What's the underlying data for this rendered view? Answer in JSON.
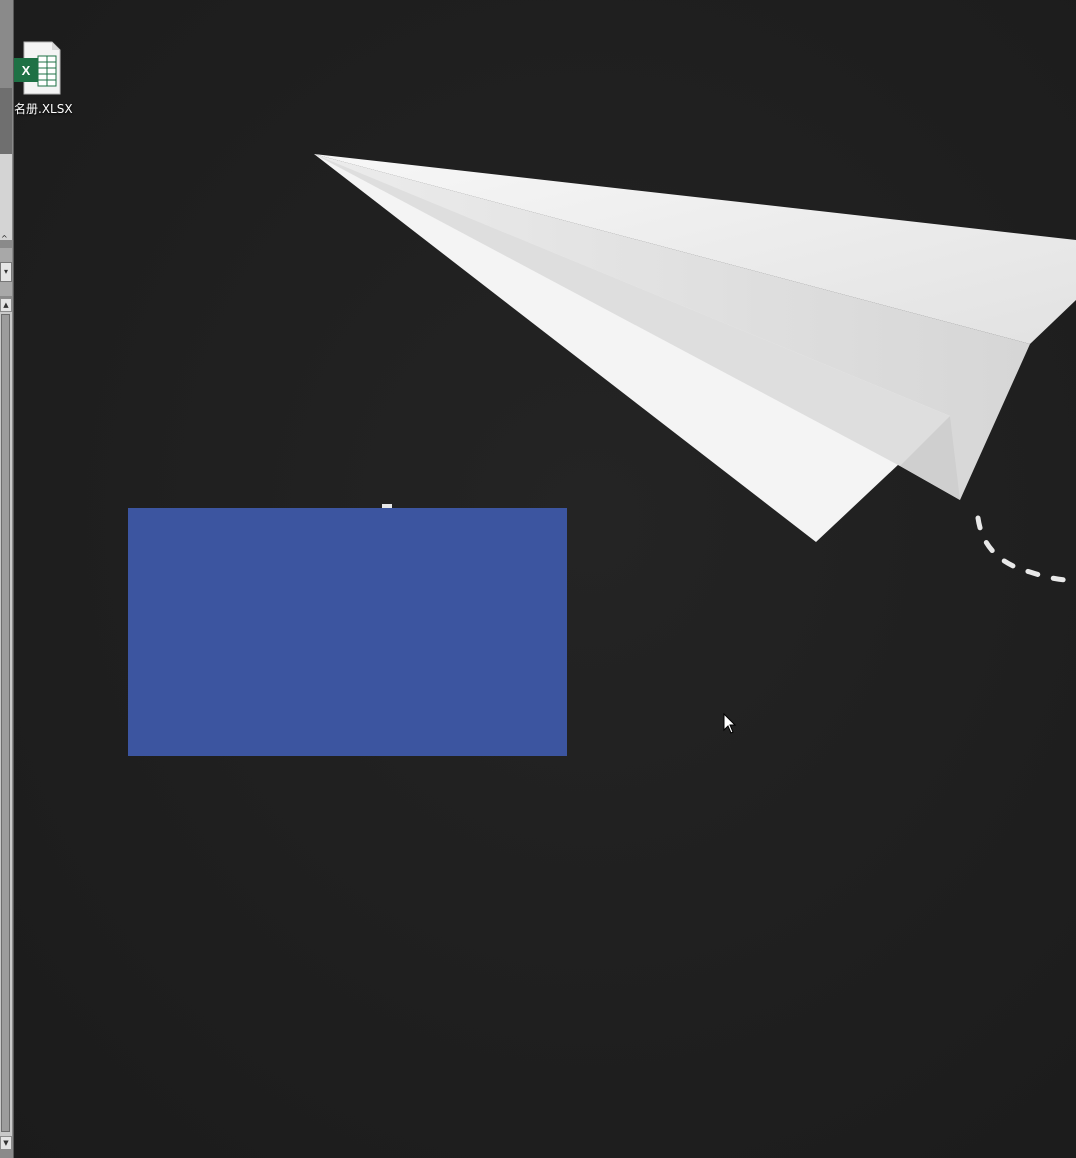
{
  "desktop": {
    "icons": [
      {
        "label": "名册.XLSX",
        "icon": "excel-file-icon",
        "badge": "X"
      }
    ],
    "wallpaper": "paper-plane-dark",
    "colors": {
      "background": "#1e1e1e",
      "blue_panel": "#3c55a0",
      "excel_green": "#1e7145"
    }
  },
  "left_window": {
    "scrollbar": {
      "up_glyph": "▲",
      "down_glyph": "▼"
    },
    "dropdown_glyph": "▾",
    "caret_glyph": "^"
  }
}
